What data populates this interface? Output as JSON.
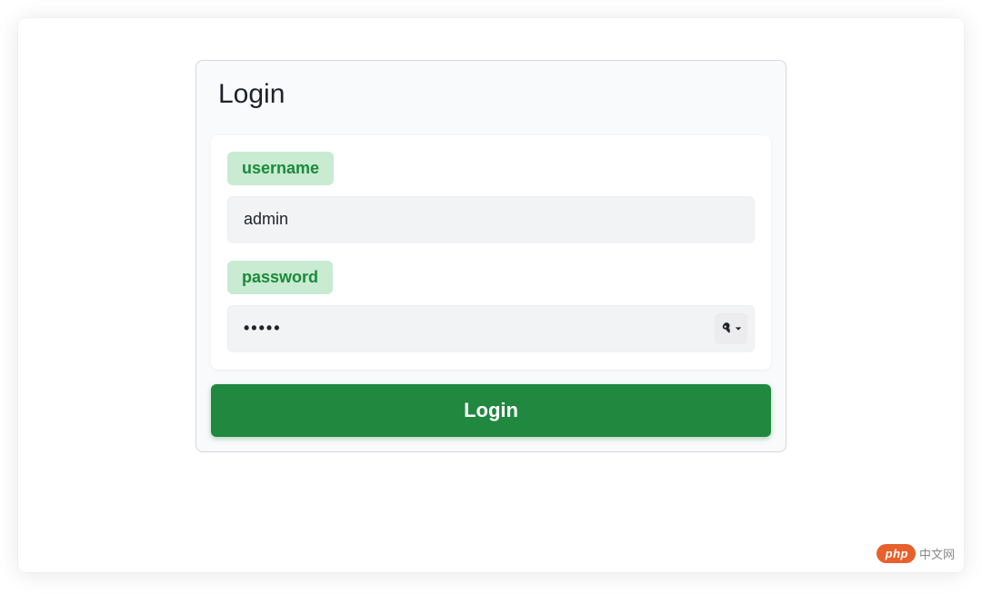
{
  "panel": {
    "title": "Login"
  },
  "form": {
    "username_label": "username",
    "username_value": "admin",
    "password_label": "password",
    "password_value": "•••••"
  },
  "actions": {
    "login_button": "Login"
  },
  "watermark": {
    "pill": "php",
    "text": "中文网"
  }
}
